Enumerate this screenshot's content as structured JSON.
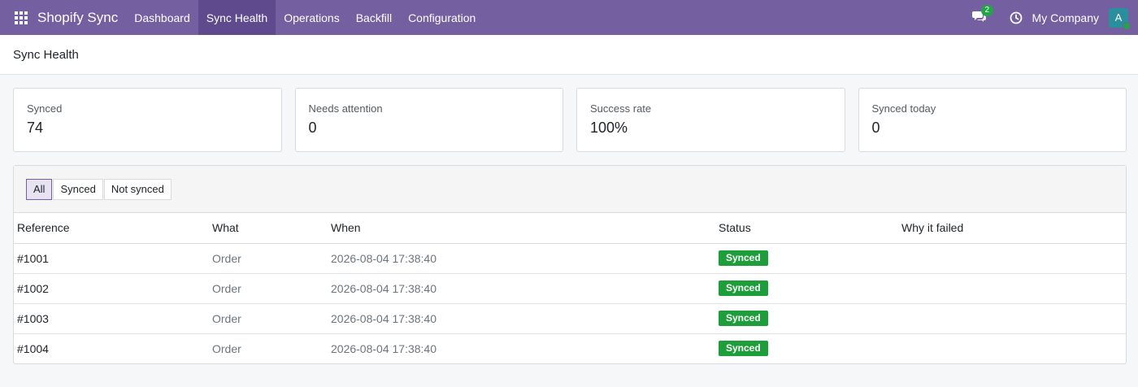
{
  "navbar": {
    "brand": "Shopify Sync",
    "menu": [
      "Dashboard",
      "Sync Health",
      "Operations",
      "Backfill",
      "Configuration"
    ],
    "active_menu": "Sync Health",
    "chat_count": "2",
    "company": "My Company",
    "avatar_initial": "A"
  },
  "page": {
    "title": "Sync Health"
  },
  "kpis": [
    {
      "label": "Synced",
      "value": "74"
    },
    {
      "label": "Needs attention",
      "value": "0"
    },
    {
      "label": "Success rate",
      "value": "100%"
    },
    {
      "label": "Synced today",
      "value": "0"
    }
  ],
  "filters": {
    "items": [
      "All",
      "Synced",
      "Not synced"
    ],
    "active": "All"
  },
  "table": {
    "columns": [
      "Reference",
      "What",
      "When",
      "Status",
      "Why it failed"
    ],
    "rows": [
      {
        "reference": "#1001",
        "what": "Order",
        "when": "2026-08-04 17:38:40",
        "status": "Synced",
        "reason": ""
      },
      {
        "reference": "#1002",
        "what": "Order",
        "when": "2026-08-04 17:38:40",
        "status": "Synced",
        "reason": ""
      },
      {
        "reference": "#1003",
        "what": "Order",
        "when": "2026-08-04 17:38:40",
        "status": "Synced",
        "reason": ""
      },
      {
        "reference": "#1004",
        "what": "Order",
        "when": "2026-08-04 17:38:40",
        "status": "Synced",
        "reason": ""
      }
    ]
  },
  "colors": {
    "navbar": "#745fa1",
    "success": "#1e9e3b"
  },
  "icons": {
    "apps": "apps-grid-icon",
    "chat": "chat-icon",
    "clock": "clock-icon"
  }
}
